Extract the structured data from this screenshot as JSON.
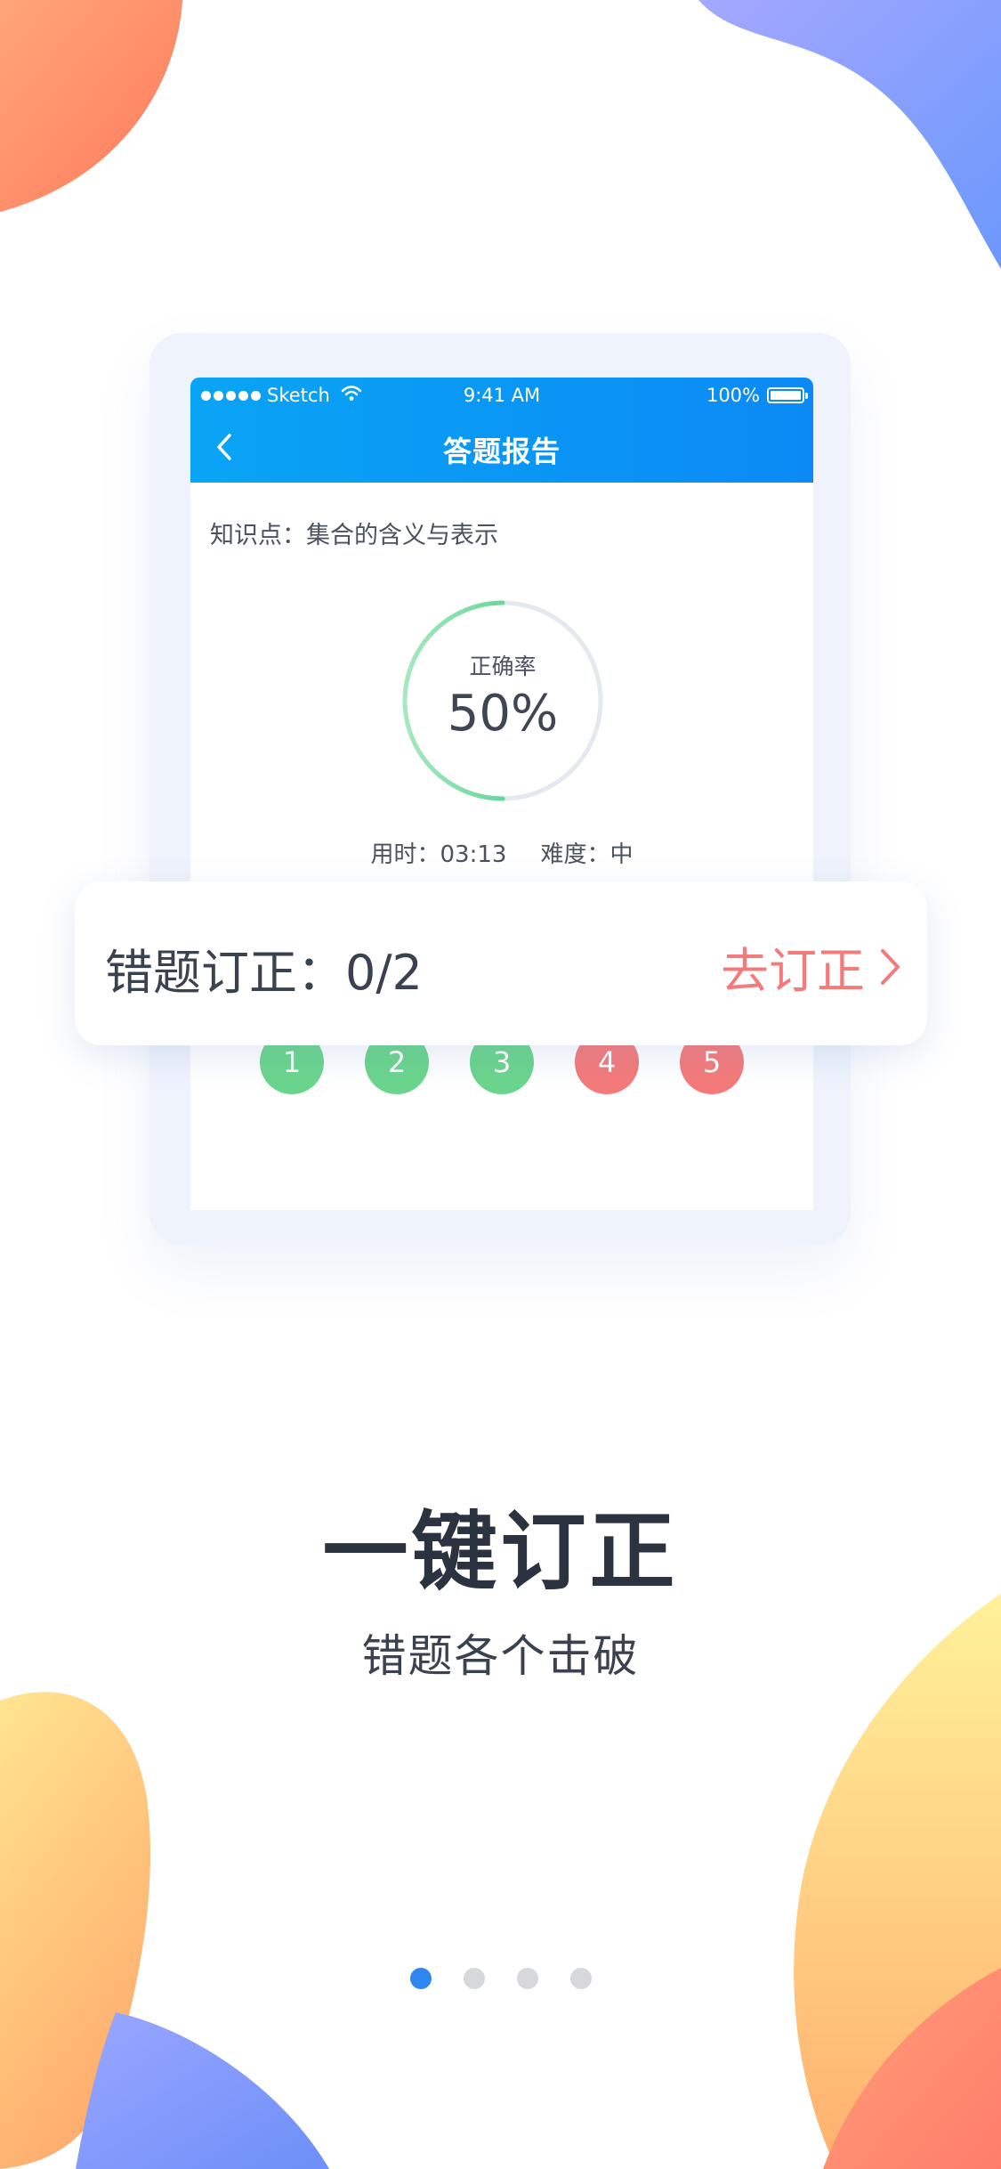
{
  "colors": {
    "header_gradient_start": "#0aa4f5",
    "header_gradient_end": "#0b8af5",
    "progress_green": "#2ac57a",
    "correct_green": "#6ad58c",
    "wrong_red": "#f47a7a",
    "action_red": "#f47b7b",
    "active_dot": "#2f86f0",
    "inactive_dot": "#d6d8dc"
  },
  "status_bar": {
    "carrier": "Sketch",
    "time": "9:41 AM",
    "battery": "100%"
  },
  "nav": {
    "back_icon": "chevron-left-icon",
    "title": "答题报告"
  },
  "report": {
    "knowledge": "知识点：集合的含义与表示",
    "accuracy_label": "正确率",
    "accuracy_value": "50%",
    "accuracy_fraction": 0.5,
    "time_used": "用时：03:13",
    "difficulty": "难度：中",
    "questions": [
      {
        "number": "1",
        "status": "correct"
      },
      {
        "number": "2",
        "status": "correct"
      },
      {
        "number": "3",
        "status": "correct"
      },
      {
        "number": "4",
        "status": "wrong"
      },
      {
        "number": "5",
        "status": "wrong"
      }
    ]
  },
  "correction_card": {
    "label": "错题订正：0/2",
    "action": "去订正",
    "action_icon": "chevron-right-icon"
  },
  "onboarding": {
    "headline": "一键订正",
    "subline": "错题各个击破",
    "page_count": 4,
    "active_page": 1
  }
}
